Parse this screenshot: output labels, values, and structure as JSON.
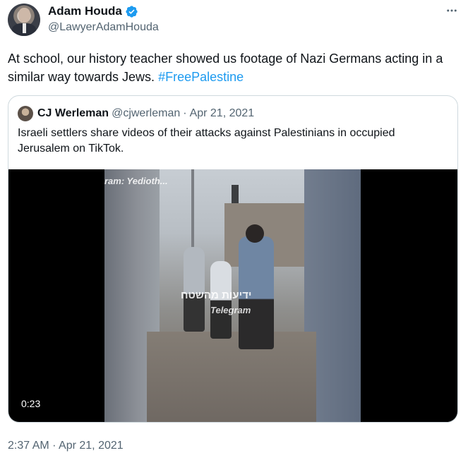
{
  "author": {
    "name": "Adam Houda",
    "handle": "@LawyerAdamHouda",
    "verified": true,
    "avatar_icon": "profile-photo"
  },
  "tweet": {
    "text": "At school, our history teacher showed us footage of Nazi Germans acting in a similar way towards Jews.",
    "hashtag": "#FreePalestine",
    "timestamp": "2:37 AM · Apr 21, 2021"
  },
  "quoted_tweet": {
    "name": "CJ Werleman",
    "handle": "@cjwerleman",
    "date": "Apr 21, 2021",
    "separator": "·",
    "text": "Israeli settlers share videos of their attacks against Palestinians in occupied Jerusalem on TikTok.",
    "video": {
      "duration": "0:23",
      "watermark_top": "ram: Yedioth...",
      "watermark_hebrew": "ידיעות מהשטח",
      "watermark_telegram": "Telegram"
    }
  },
  "colors": {
    "accent": "#1d9bf0",
    "text_primary": "#0f1419",
    "text_secondary": "#536471",
    "border": "#cfd9de"
  },
  "icons": {
    "more": "ellipsis-icon",
    "verified": "verified-badge-icon"
  }
}
